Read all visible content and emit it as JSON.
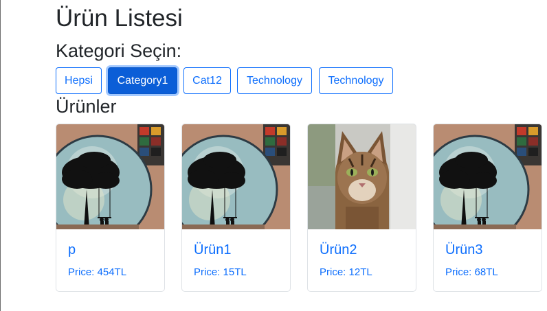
{
  "header": {
    "title": "Ürün Listesi"
  },
  "categories": {
    "title": "Kategori Seçin:",
    "buttons": [
      {
        "label": "Hepsi",
        "active": false
      },
      {
        "label": "Category1",
        "active": true
      },
      {
        "label": "Cat12",
        "active": false
      },
      {
        "label": "Technology",
        "active": false
      },
      {
        "label": "Technology",
        "active": false
      }
    ]
  },
  "products": {
    "title": "Ürünler",
    "items": [
      {
        "name": "p",
        "price": "Price: 454TL",
        "image": "tree-painting-image"
      },
      {
        "name": "Ürün1",
        "price": "Price: 15TL",
        "image": "tree-painting-image"
      },
      {
        "name": "Ürün2",
        "price": "Price: 12TL",
        "image": "cat-photo-image"
      },
      {
        "name": "Ürün3",
        "price": "Price: 68TL",
        "image": "tree-painting-image"
      }
    ]
  },
  "colors": {
    "primary": "#0d6efd",
    "active": "#0b5ed7"
  }
}
